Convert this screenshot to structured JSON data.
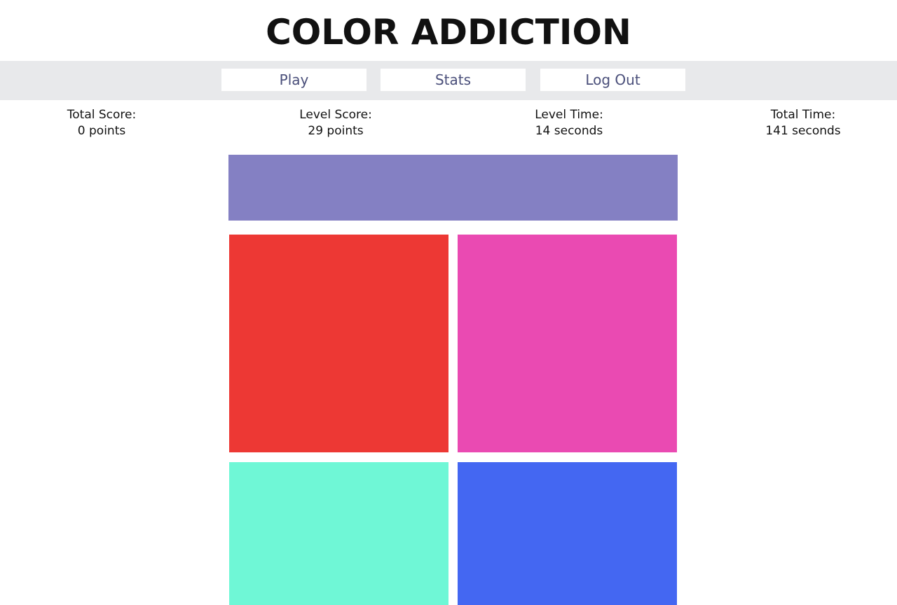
{
  "header": {
    "title": "COLOR ADDICTION"
  },
  "nav": {
    "play_label": "Play",
    "stats_label": "Stats",
    "logout_label": "Log Out"
  },
  "stats": {
    "total_score_label": "Total Score:",
    "total_score_value": "0 points",
    "level_score_label": "Level Score:",
    "level_score_value": "29 points",
    "level_time_label": "Level Time:",
    "level_time_value": "14 seconds",
    "total_time_label": "Total Time:",
    "total_time_value": "141 seconds"
  },
  "game": {
    "target_color": "#8480c3",
    "tiles": [
      {
        "color": "#ed3834"
      },
      {
        "color": "#ea4ab2"
      },
      {
        "color": "#6ff7d6"
      },
      {
        "color": "#4467f2"
      }
    ]
  }
}
